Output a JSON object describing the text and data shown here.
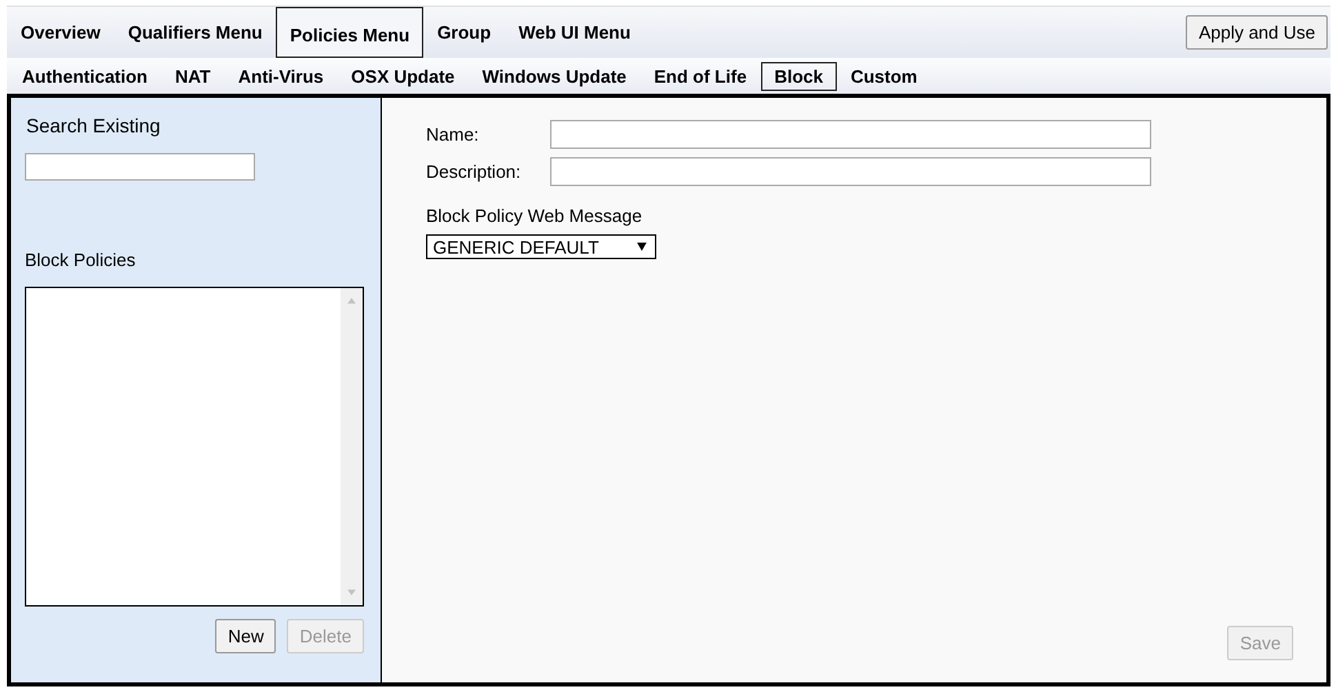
{
  "main_menu": [
    {
      "label": "Overview",
      "selected": false
    },
    {
      "label": "Qualifiers Menu",
      "selected": false
    },
    {
      "label": "Policies Menu",
      "selected": true
    },
    {
      "label": "Group",
      "selected": false
    },
    {
      "label": "Web UI Menu",
      "selected": false
    }
  ],
  "apply_button": "Apply and Use",
  "sub_menu": [
    {
      "label": "Authentication",
      "selected": false
    },
    {
      "label": "NAT",
      "selected": false
    },
    {
      "label": "Anti-Virus",
      "selected": false
    },
    {
      "label": "OSX Update",
      "selected": false
    },
    {
      "label": "Windows Update",
      "selected": false
    },
    {
      "label": "End of Life",
      "selected": false
    },
    {
      "label": "Block",
      "selected": true
    },
    {
      "label": "Custom",
      "selected": false
    }
  ],
  "sidebar": {
    "search_label": "Search Existing",
    "list_label": "Block Policies",
    "buttons": [
      {
        "label": "New",
        "disabled": false
      },
      {
        "label": "Delete",
        "disabled": true
      }
    ]
  },
  "form": {
    "fields": [
      {
        "label": "Name:"
      },
      {
        "label": "Description:"
      }
    ],
    "message_label": "Block Policy Web Message",
    "message_value": "GENERIC DEFAULT",
    "save": {
      "label": "Save",
      "disabled": true
    }
  }
}
